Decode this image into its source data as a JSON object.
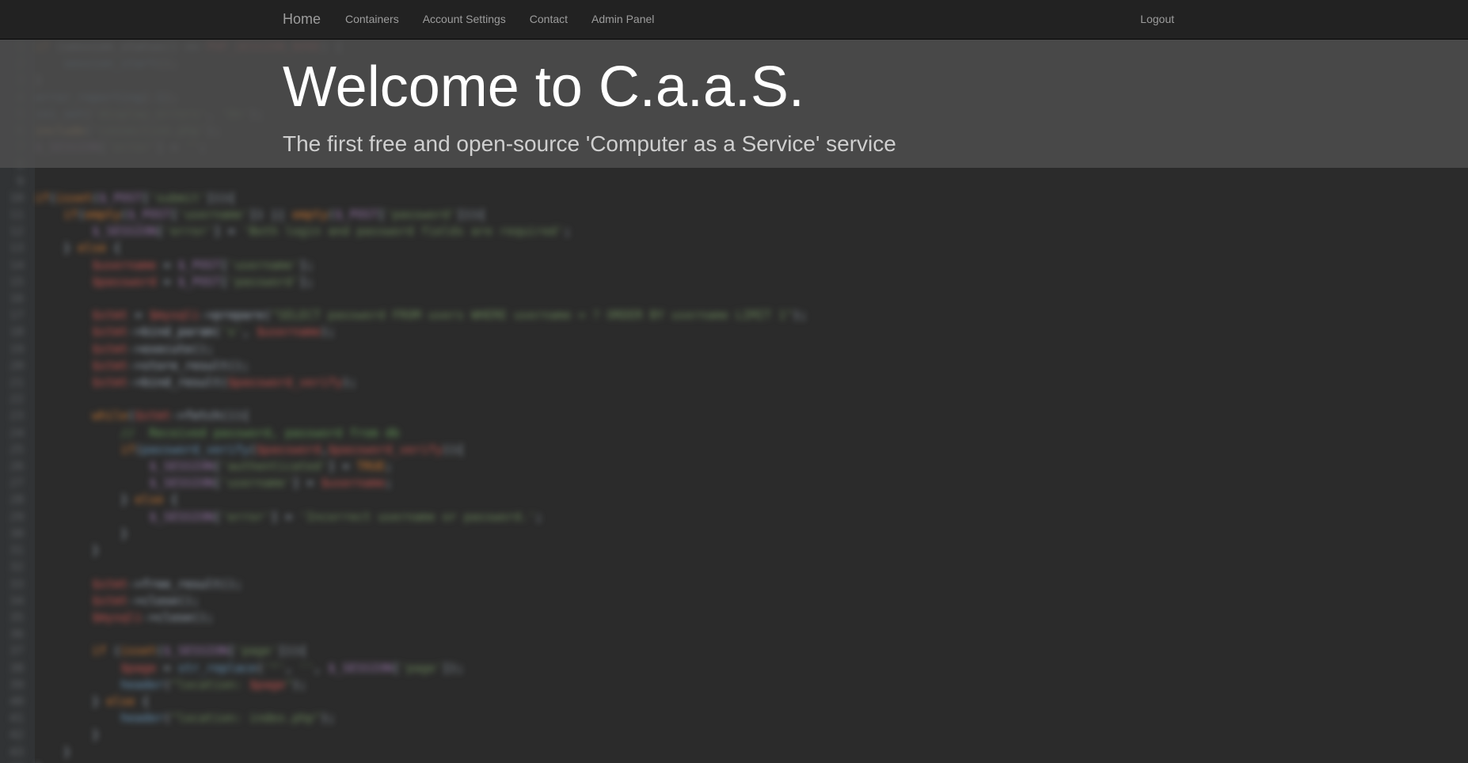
{
  "navbar": {
    "brand": "Home",
    "links": [
      "Containers",
      "Account Settings",
      "Contact",
      "Admin Panel"
    ],
    "logout": "Logout"
  },
  "jumbotron": {
    "title": "Welcome to C.a.a.S.",
    "subtitle": "The first free and open-source 'Computer as a Service' service"
  },
  "colors": {
    "navbar_bg": "#222222",
    "nav_text": "#9d9d9d",
    "jumbotron_bg": "#4d4d4d",
    "page_bg": "#2b2b2b"
  }
}
